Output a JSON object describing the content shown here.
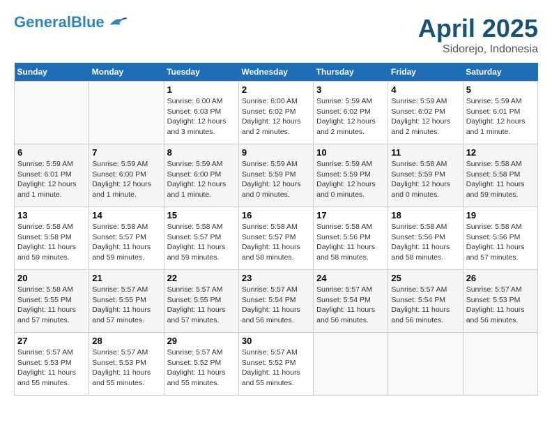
{
  "header": {
    "logo_line1": "General",
    "logo_line2": "Blue",
    "month": "April 2025",
    "location": "Sidorejo, Indonesia"
  },
  "days_of_week": [
    "Sunday",
    "Monday",
    "Tuesday",
    "Wednesday",
    "Thursday",
    "Friday",
    "Saturday"
  ],
  "weeks": [
    [
      {
        "day": "",
        "info": ""
      },
      {
        "day": "",
        "info": ""
      },
      {
        "day": "1",
        "info": "Sunrise: 6:00 AM\nSunset: 6:03 PM\nDaylight: 12 hours\nand 3 minutes."
      },
      {
        "day": "2",
        "info": "Sunrise: 6:00 AM\nSunset: 6:02 PM\nDaylight: 12 hours\nand 2 minutes."
      },
      {
        "day": "3",
        "info": "Sunrise: 5:59 AM\nSunset: 6:02 PM\nDaylight: 12 hours\nand 2 minutes."
      },
      {
        "day": "4",
        "info": "Sunrise: 5:59 AM\nSunset: 6:02 PM\nDaylight: 12 hours\nand 2 minutes."
      },
      {
        "day": "5",
        "info": "Sunrise: 5:59 AM\nSunset: 6:01 PM\nDaylight: 12 hours\nand 1 minute."
      }
    ],
    [
      {
        "day": "6",
        "info": "Sunrise: 5:59 AM\nSunset: 6:01 PM\nDaylight: 12 hours\nand 1 minute."
      },
      {
        "day": "7",
        "info": "Sunrise: 5:59 AM\nSunset: 6:00 PM\nDaylight: 12 hours\nand 1 minute."
      },
      {
        "day": "8",
        "info": "Sunrise: 5:59 AM\nSunset: 6:00 PM\nDaylight: 12 hours\nand 1 minute."
      },
      {
        "day": "9",
        "info": "Sunrise: 5:59 AM\nSunset: 5:59 PM\nDaylight: 12 hours\nand 0 minutes."
      },
      {
        "day": "10",
        "info": "Sunrise: 5:59 AM\nSunset: 5:59 PM\nDaylight: 12 hours\nand 0 minutes."
      },
      {
        "day": "11",
        "info": "Sunrise: 5:58 AM\nSunset: 5:59 PM\nDaylight: 12 hours\nand 0 minutes."
      },
      {
        "day": "12",
        "info": "Sunrise: 5:58 AM\nSunset: 5:58 PM\nDaylight: 11 hours\nand 59 minutes."
      }
    ],
    [
      {
        "day": "13",
        "info": "Sunrise: 5:58 AM\nSunset: 5:58 PM\nDaylight: 11 hours\nand 59 minutes."
      },
      {
        "day": "14",
        "info": "Sunrise: 5:58 AM\nSunset: 5:57 PM\nDaylight: 11 hours\nand 59 minutes."
      },
      {
        "day": "15",
        "info": "Sunrise: 5:58 AM\nSunset: 5:57 PM\nDaylight: 11 hours\nand 59 minutes."
      },
      {
        "day": "16",
        "info": "Sunrise: 5:58 AM\nSunset: 5:57 PM\nDaylight: 11 hours\nand 58 minutes."
      },
      {
        "day": "17",
        "info": "Sunrise: 5:58 AM\nSunset: 5:56 PM\nDaylight: 11 hours\nand 58 minutes."
      },
      {
        "day": "18",
        "info": "Sunrise: 5:58 AM\nSunset: 5:56 PM\nDaylight: 11 hours\nand 58 minutes."
      },
      {
        "day": "19",
        "info": "Sunrise: 5:58 AM\nSunset: 5:56 PM\nDaylight: 11 hours\nand 57 minutes."
      }
    ],
    [
      {
        "day": "20",
        "info": "Sunrise: 5:58 AM\nSunset: 5:55 PM\nDaylight: 11 hours\nand 57 minutes."
      },
      {
        "day": "21",
        "info": "Sunrise: 5:57 AM\nSunset: 5:55 PM\nDaylight: 11 hours\nand 57 minutes."
      },
      {
        "day": "22",
        "info": "Sunrise: 5:57 AM\nSunset: 5:55 PM\nDaylight: 11 hours\nand 57 minutes."
      },
      {
        "day": "23",
        "info": "Sunrise: 5:57 AM\nSunset: 5:54 PM\nDaylight: 11 hours\nand 56 minutes."
      },
      {
        "day": "24",
        "info": "Sunrise: 5:57 AM\nSunset: 5:54 PM\nDaylight: 11 hours\nand 56 minutes."
      },
      {
        "day": "25",
        "info": "Sunrise: 5:57 AM\nSunset: 5:54 PM\nDaylight: 11 hours\nand 56 minutes."
      },
      {
        "day": "26",
        "info": "Sunrise: 5:57 AM\nSunset: 5:53 PM\nDaylight: 11 hours\nand 56 minutes."
      }
    ],
    [
      {
        "day": "27",
        "info": "Sunrise: 5:57 AM\nSunset: 5:53 PM\nDaylight: 11 hours\nand 55 minutes."
      },
      {
        "day": "28",
        "info": "Sunrise: 5:57 AM\nSunset: 5:53 PM\nDaylight: 11 hours\nand 55 minutes."
      },
      {
        "day": "29",
        "info": "Sunrise: 5:57 AM\nSunset: 5:52 PM\nDaylight: 11 hours\nand 55 minutes."
      },
      {
        "day": "30",
        "info": "Sunrise: 5:57 AM\nSunset: 5:52 PM\nDaylight: 11 hours\nand 55 minutes."
      },
      {
        "day": "",
        "info": ""
      },
      {
        "day": "",
        "info": ""
      },
      {
        "day": "",
        "info": ""
      }
    ]
  ]
}
